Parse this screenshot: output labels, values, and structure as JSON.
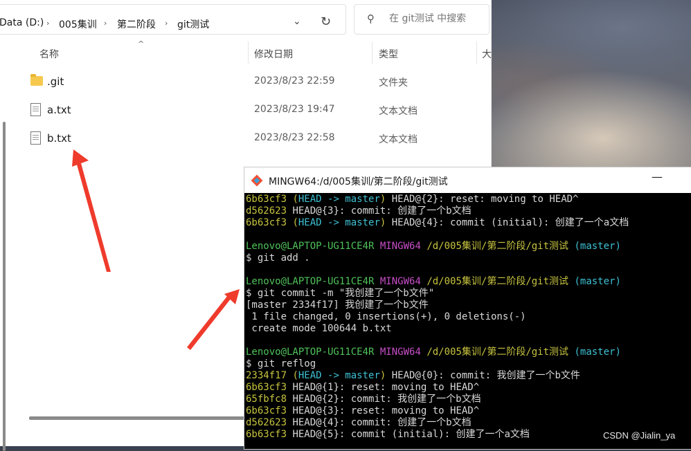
{
  "explorer": {
    "breadcrumbs": [
      "Data (D:)",
      "005集训",
      "第二阶段",
      "git测试"
    ],
    "search_placeholder": "在 git测试 中搜索",
    "columns": [
      "名称",
      "修改日期",
      "类型",
      "大"
    ],
    "files": [
      {
        "name": ".git",
        "date": "2023/8/23 22:59",
        "type": "文件夹",
        "icon": "folder-icon"
      },
      {
        "name": "a.txt",
        "date": "2023/8/23 19:47",
        "type": "文本文档",
        "icon": "text-file-icon"
      },
      {
        "name": "b.txt",
        "date": "2023/8/23 22:58",
        "type": "文本文档",
        "icon": "text-file-icon"
      }
    ]
  },
  "terminal": {
    "title": "MINGW64:/d/005集训/第二阶段/git测试",
    "lines": [
      [
        {
          "t": "6b63cf3 ",
          "c": "yel"
        },
        {
          "t": "(",
          "c": "yel"
        },
        {
          "t": "HEAD -> master",
          "c": "cyan"
        },
        {
          "t": ")",
          "c": "yel"
        },
        {
          "t": " HEAD@{2}: reset: moving to HEAD^",
          "c": "wht"
        }
      ],
      [
        {
          "t": "d562623",
          "c": "yel"
        },
        {
          "t": " HEAD@{3}: commit: 创建了一个b文档",
          "c": "wht"
        }
      ],
      [
        {
          "t": "6b63cf3 ",
          "c": "yel"
        },
        {
          "t": "(",
          "c": "yel"
        },
        {
          "t": "HEAD -> master",
          "c": "cyan"
        },
        {
          "t": ")",
          "c": "yel"
        },
        {
          "t": " HEAD@{4}: commit (initial): 创建了一个a文档",
          "c": "wht"
        }
      ],
      [],
      [
        {
          "t": "Lenovo@LAPTOP-UG11CE4R ",
          "c": "grn"
        },
        {
          "t": "MINGW64 ",
          "c": "mag"
        },
        {
          "t": "/d/005集训/第二阶段/git测试 ",
          "c": "yel"
        },
        {
          "t": "(master)",
          "c": "cyan"
        }
      ],
      [
        {
          "t": "$ git add .",
          "c": "wht"
        }
      ],
      [],
      [
        {
          "t": "Lenovo@LAPTOP-UG11CE4R ",
          "c": "grn"
        },
        {
          "t": "MINGW64 ",
          "c": "mag"
        },
        {
          "t": "/d/005集训/第二阶段/git测试 ",
          "c": "yel"
        },
        {
          "t": "(master)",
          "c": "cyan"
        }
      ],
      [
        {
          "t": "$ git commit -m \"我创建了一个b文件\"",
          "c": "wht"
        }
      ],
      [
        {
          "t": "[master 2334f17] 我创建了一个b文件",
          "c": "wht"
        }
      ],
      [
        {
          "t": " 1 file changed, 0 insertions(+), 0 deletions(-)",
          "c": "wht"
        }
      ],
      [
        {
          "t": " create mode 100644 b.txt",
          "c": "wht"
        }
      ],
      [],
      [
        {
          "t": "Lenovo@LAPTOP-UG11CE4R ",
          "c": "grn"
        },
        {
          "t": "MINGW64 ",
          "c": "mag"
        },
        {
          "t": "/d/005集训/第二阶段/git测试 ",
          "c": "yel"
        },
        {
          "t": "(master)",
          "c": "cyan"
        }
      ],
      [
        {
          "t": "$ git reflog",
          "c": "wht"
        }
      ],
      [
        {
          "t": "2334f17 ",
          "c": "yel"
        },
        {
          "t": "(",
          "c": "yel"
        },
        {
          "t": "HEAD -> master",
          "c": "cyan"
        },
        {
          "t": ")",
          "c": "yel"
        },
        {
          "t": " HEAD@{0}: commit: 我创建了一个b文件",
          "c": "wht"
        }
      ],
      [
        {
          "t": "6b63cf3",
          "c": "yel"
        },
        {
          "t": " HEAD@{1}: reset: moving to HEAD^",
          "c": "wht"
        }
      ],
      [
        {
          "t": "65fbfc8",
          "c": "yel"
        },
        {
          "t": " HEAD@{2}: commit: 我创建了一个b文档",
          "c": "wht"
        }
      ],
      [
        {
          "t": "6b63cf3",
          "c": "yel"
        },
        {
          "t": " HEAD@{3}: reset: moving to HEAD^",
          "c": "wht"
        }
      ],
      [
        {
          "t": "d562623",
          "c": "yel"
        },
        {
          "t": " HEAD@{4}: commit: 创建了一个b文档",
          "c": "wht"
        }
      ],
      [
        {
          "t": "6b63cf3",
          "c": "yel"
        },
        {
          "t": " HEAD@{5}: commit (initial): 创建了一个a文档",
          "c": "wht"
        }
      ]
    ]
  },
  "watermark": "CSDN @Jialin_ya",
  "colors": {
    "arrow": "#ef3b2c",
    "terminal_bg": "#000000",
    "hash_yellow": "#c7c43f",
    "branch_cyan": "#3ec1d3",
    "prompt_green": "#4fc25a",
    "mingw_magenta": "#c74ec7"
  }
}
